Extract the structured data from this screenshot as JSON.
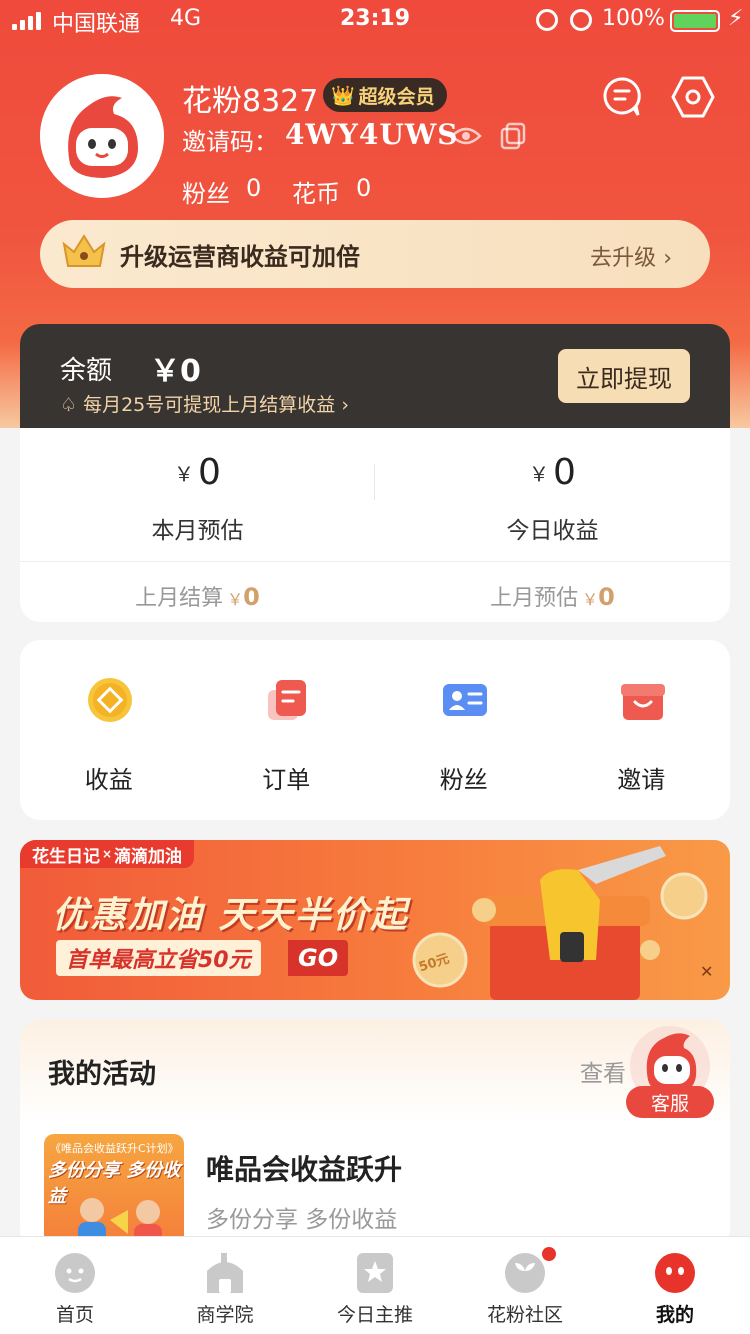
{
  "status_bar": {
    "carrier": "中国联通",
    "network": "4G",
    "time": "23:19",
    "battery": "100%"
  },
  "profile": {
    "nickname": "花粉8327",
    "vip_badge": "超级会员",
    "invite_label": "邀请码：",
    "invite_code": "4WY4UWS",
    "fans_label": "粉丝",
    "fans_count": "0",
    "coins_label": "花币",
    "coins_count": "0"
  },
  "upgrade": {
    "text": "升级运营商收益可加倍",
    "link": "去升级"
  },
  "balance": {
    "label": "余额",
    "amount": "￥0",
    "tip": "每月25号可提现上月结算收益",
    "withdraw_button": "立即提现"
  },
  "earnings": {
    "currency": "￥",
    "month_estimate_value": "0",
    "month_estimate_label": "本月预估",
    "today_value": "0",
    "today_label": "今日收益",
    "last_month_settled_label": "上月结算",
    "last_month_settled_value": "0",
    "last_month_estimate_label": "上月预估",
    "last_month_estimate_value": "0"
  },
  "actions": [
    {
      "label": "收益",
      "icon": "earnings-coin-icon"
    },
    {
      "label": "订单",
      "icon": "order-document-icon"
    },
    {
      "label": "粉丝",
      "icon": "fans-id-card-icon"
    },
    {
      "label": "邀请",
      "icon": "invite-gift-icon"
    }
  ],
  "promo": {
    "tag_brand": "花生日记",
    "tag_partner": "滴滴加油",
    "title": "优惠加油 天天半价起",
    "subtitle": "首单最高立省50元",
    "go": "GO",
    "coin_label": "50元"
  },
  "activities": {
    "title": "我的活动",
    "more": "查看",
    "item_thumb_caption": "《唯品会收益跃升C计划》",
    "item_thumb_title": "多份分享 多份收益",
    "item_name": "唯品会收益跃升",
    "item_desc": "多份分享 多份收益"
  },
  "customer_service": {
    "label": "客服"
  },
  "tabs": [
    {
      "label": "首页",
      "icon": "home-face-icon"
    },
    {
      "label": "商学院",
      "icon": "school-icon"
    },
    {
      "label": "今日主推",
      "icon": "star-icon"
    },
    {
      "label": "花粉社区",
      "icon": "sprout-icon"
    },
    {
      "label": "我的",
      "icon": "profile-face-icon"
    }
  ],
  "colors": {
    "primary_red": "#ef4a3c",
    "gold": "#d3a06b",
    "dark_card": "#383432"
  }
}
